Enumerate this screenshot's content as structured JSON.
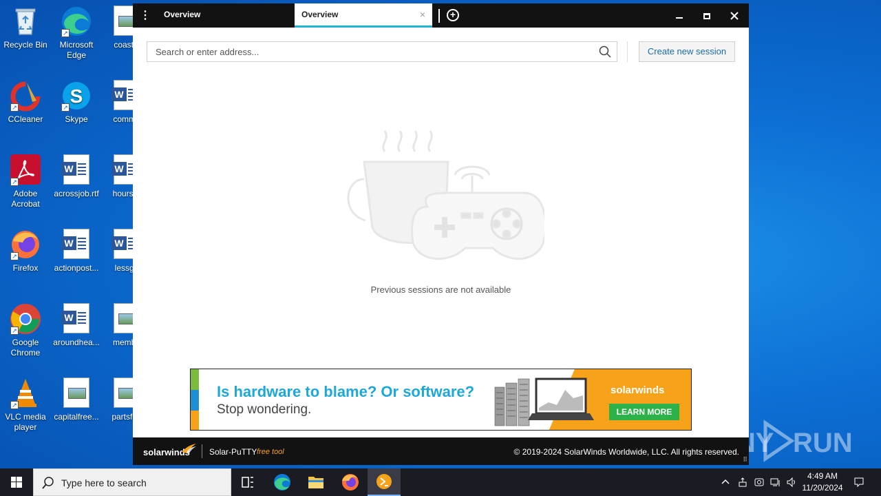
{
  "desktop": {
    "icons": [
      {
        "label": "Recycle Bin",
        "icon": "recycle-bin-icon"
      },
      {
        "label": "Microsoft Edge",
        "icon": "edge-icon"
      },
      {
        "label": "coastw",
        "icon": "image-file-icon"
      },
      {
        "label": "CCleaner",
        "icon": "ccleaner-icon"
      },
      {
        "label": "Skype",
        "icon": "skype-icon"
      },
      {
        "label": "comma",
        "icon": "word-doc-icon"
      },
      {
        "label": "Adobe Acrobat",
        "icon": "acrobat-icon"
      },
      {
        "label": "acrossjob.rtf",
        "icon": "word-doc-icon"
      },
      {
        "label": "hoursre",
        "icon": "word-doc-icon"
      },
      {
        "label": "Firefox",
        "icon": "firefox-icon"
      },
      {
        "label": "actionpost...",
        "icon": "word-doc-icon"
      },
      {
        "label": "lessgo",
        "icon": "word-doc-icon"
      },
      {
        "label": "Google Chrome",
        "icon": "chrome-icon"
      },
      {
        "label": "aroundhea...",
        "icon": "word-doc-icon"
      },
      {
        "label": "membe",
        "icon": "image-file-icon"
      },
      {
        "label": "VLC media player",
        "icon": "vlc-icon"
      },
      {
        "label": "capitalfree...",
        "icon": "image-file-icon"
      },
      {
        "label": "partsfea",
        "icon": "image-file-icon"
      }
    ]
  },
  "app": {
    "tabs": [
      {
        "label": "Overview"
      },
      {
        "label": "Overview",
        "active": true
      }
    ],
    "tab_close": "×",
    "search": {
      "placeholder": "Search or enter address..."
    },
    "create_button": "Create new session",
    "empty_message": "Previous sessions are not available",
    "ad": {
      "headline": "Is hardware to blame? Or software?",
      "subline": "Stop wondering.",
      "brand": "solarwinds",
      "cta": "LEARN MORE"
    },
    "footer": {
      "brand": "solarwinds",
      "product": "Solar-PuTTY",
      "tag": "free tool",
      "copyright": "© 2019-2024 SolarWinds Worldwide, LLC. All rights reserved."
    }
  },
  "watermark": "ANY RUN",
  "taskbar": {
    "search_placeholder": "Type here to search",
    "time": "4:49 AM",
    "date": "11/20/2024"
  },
  "colors": {
    "accent": "#1fb6d6",
    "ad_orange": "#f7a21b",
    "ad_green": "#2db24a",
    "ad_blue": "#1ea8d8"
  }
}
